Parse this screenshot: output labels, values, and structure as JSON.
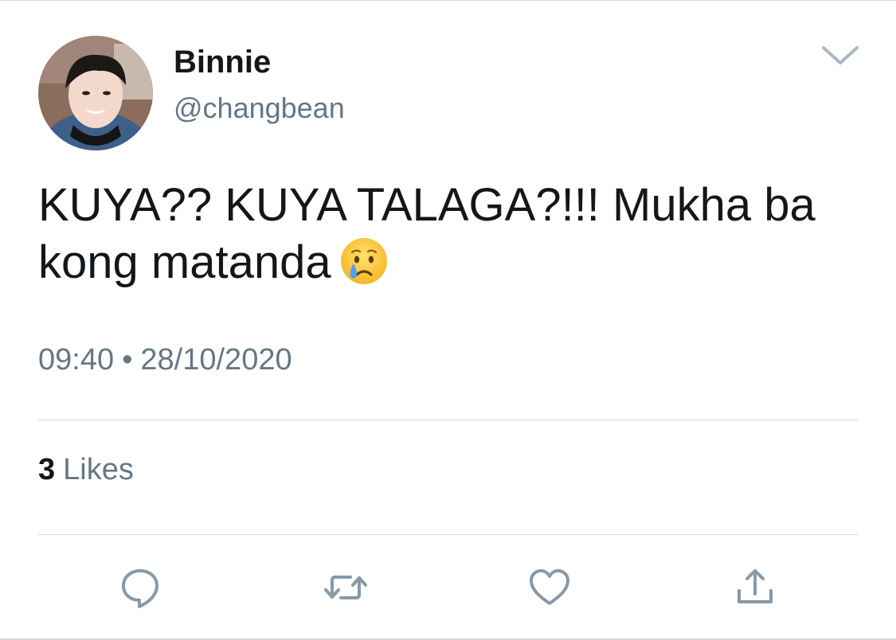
{
  "user": {
    "display_name": "Binnie",
    "handle": "@changbean"
  },
  "tweet": {
    "text": "KUYA?? KUYA TALAGA?!!! Mukha ba kong matanda",
    "emoji": "crying-face-emoji",
    "time": "09:40",
    "separator": "•",
    "date": "28/10/2020"
  },
  "stats": {
    "likes_count": "3",
    "likes_label": "Likes"
  },
  "actions": [
    "reply-icon",
    "retweet-icon",
    "like-icon",
    "share-icon"
  ],
  "colors": {
    "text": "#14171a",
    "secondary": "#657786",
    "icon": "#8899a6",
    "divider": "#d4d9dd"
  }
}
